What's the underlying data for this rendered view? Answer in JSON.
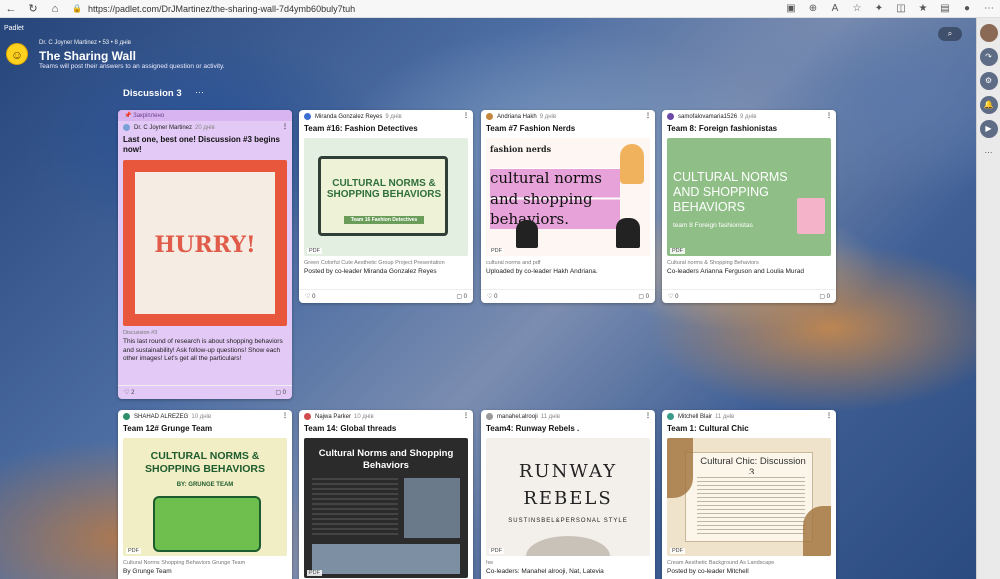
{
  "browser": {
    "url": "https://padlet.com/DrJMartinez/the-sharing-wall-7d4ymb60buly7tuh"
  },
  "header": {
    "padlet_tag": "Padlet",
    "meta": "Dr. C Joyner Martinez • 53 • 8 днів",
    "title": "The Sharing Wall",
    "description": "Teams will post their answers to an assigned question or activity."
  },
  "section": {
    "title": "Discussion 3",
    "more": "···"
  },
  "cards": [
    {
      "pin": "Закріплено",
      "author": "Dr. C Joyner Martinez",
      "time": "20 днів",
      "title": "Last one, best one! Discussion #3 begins now!",
      "thumb_text": "HURRY!",
      "caption": "Discussion #3",
      "body": "This last round of research is about shopping behaviors and sustainability! Ask follow-up questions! Show each other images! Let's get all the particulars!",
      "likes": "2",
      "comments": "0"
    },
    {
      "author": "Miranda Gonzalez Reyes",
      "time": "9 днів",
      "title": "Team #16: Fashion Detectives",
      "thumb_text": "CULTURAL NORMS & SHOPPING BEHAVIORS",
      "thumb_sub": "Team 16 Fashion Detectives",
      "pdf": "PDF",
      "caption": "Green Colorful Cute Aesthetic Group Project Presentation",
      "body": "Posted by co-leader Miranda Gonzalez Reyes",
      "likes": "0",
      "comments": "0"
    },
    {
      "author": "Andriana Hakh",
      "time": "9 днів",
      "title": "Team #7 Fashion Nerds",
      "thumb_top": "fashion nerds",
      "thumb_text": "cultural norms and shopping behaviors.",
      "pdf": "PDF",
      "caption": "cultural norms and pdf",
      "body": "Uploaded by co-leader Hakh Andriana.",
      "likes": "0",
      "comments": "0"
    },
    {
      "author": "samofalovamaria1526",
      "time": "9 днів",
      "title": "Team 8: Foreign fashionistas",
      "thumb_text": "CULTURAL NORMS AND SHOPPING BEHAVIORS",
      "thumb_sub": "team 8 Foreign fashionistas",
      "pdf": "PDF",
      "caption": "Cultural norms & Shopping Behaviors",
      "body": "Co-leaders Arianna Ferguson and Loulia Murad",
      "likes": "0",
      "comments": "0"
    },
    {
      "author": "SHAHAD ALREZEG",
      "time": "10 днів",
      "title": "Team 12# Grunge Team",
      "thumb_text": "CULTURAL NORMS & SHOPPING BEHAVIORS",
      "thumb_sub": "BY: GRUNGE TEAM",
      "pdf": "PDF",
      "caption": "Cultural Norms Shopping Behaviors Grunge Team",
      "body": "By Grunge Team"
    },
    {
      "author": "Najwa Parker",
      "time": "10 днів",
      "title": "Team 14: Global threads",
      "thumb_text": "Cultural Norms and Shopping Behaviors",
      "pdf": "PDF",
      "caption": "",
      "body": ""
    },
    {
      "author": "manahel.alrooji",
      "time": "11 днів",
      "title": "Team4: Runway Rebels .",
      "thumb_text": "RUNWAY REBELS",
      "thumb_sub": "SUSTINSBEL&PERSONAL STYLE",
      "pdf": "PDF",
      "caption": "hw",
      "body": "Co-leaders: Manahel alrooji, Nat, Latevia"
    },
    {
      "author": "Mitchell Blair",
      "time": "11 днів",
      "title": "Team 1: Cultural Chic",
      "thumb_text": "Cultural Chic: Discussion 3.",
      "pdf": "PDF",
      "caption": "Cream Aesthetic Background As Landscape",
      "body": "Posted by co-leader Mitchell"
    }
  ],
  "rightbar": {
    "items": [
      "↷",
      "⚙",
      "🔔",
      "▶",
      "⋯"
    ]
  }
}
